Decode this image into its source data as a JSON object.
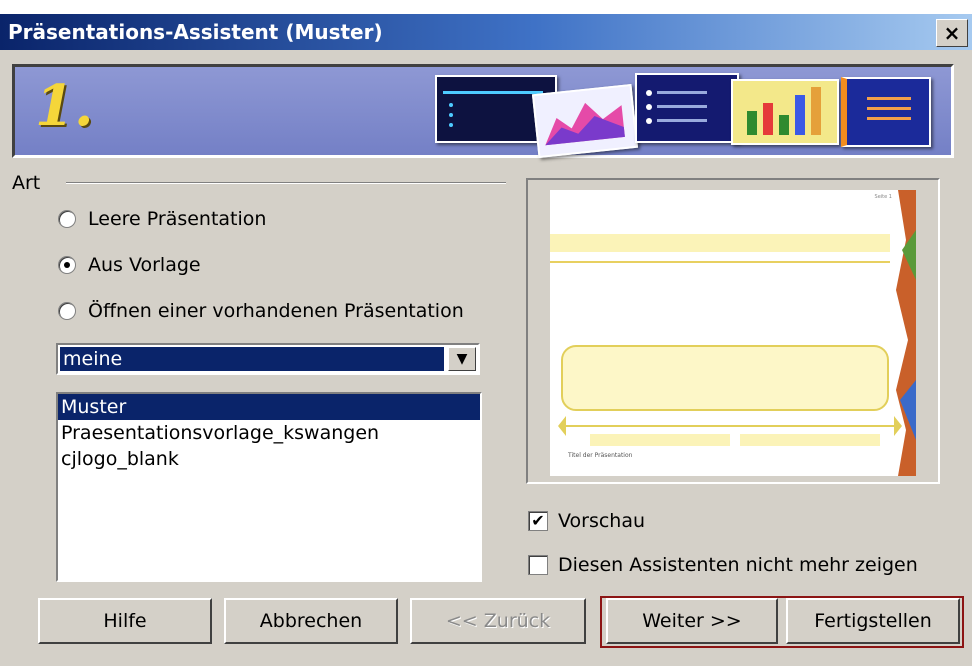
{
  "window": {
    "title": "Präsentations-Assistent (Muster)",
    "close_label": "×"
  },
  "banner": {
    "step_number": "1."
  },
  "art": {
    "group_label": "Art",
    "options": [
      {
        "label": "Leere Präsentation",
        "checked": false
      },
      {
        "label": "Aus Vorlage",
        "checked": true
      },
      {
        "label": "Öffnen einer vorhandenen Präsentation",
        "checked": false
      }
    ]
  },
  "category_select": {
    "value": "meine",
    "arrow": "▼"
  },
  "templates": {
    "items": [
      "Muster",
      "Praesentationsvorlage_kswangen",
      "cjlogo_blank"
    ],
    "selected_index": 0
  },
  "preview_slide": {
    "footer_text": "Titel der Präsentation",
    "page_label": "Seite 1"
  },
  "options": {
    "preview": {
      "label": "Vorschau",
      "checked": true
    },
    "dont_show": {
      "label": "Diesen Assistenten nicht mehr zeigen",
      "checked": false
    }
  },
  "buttons": {
    "help": "Hilfe",
    "cancel": "Abbrechen",
    "back": "<< Zurück",
    "next": "Weiter >>",
    "finish": "Fertigstellen"
  }
}
